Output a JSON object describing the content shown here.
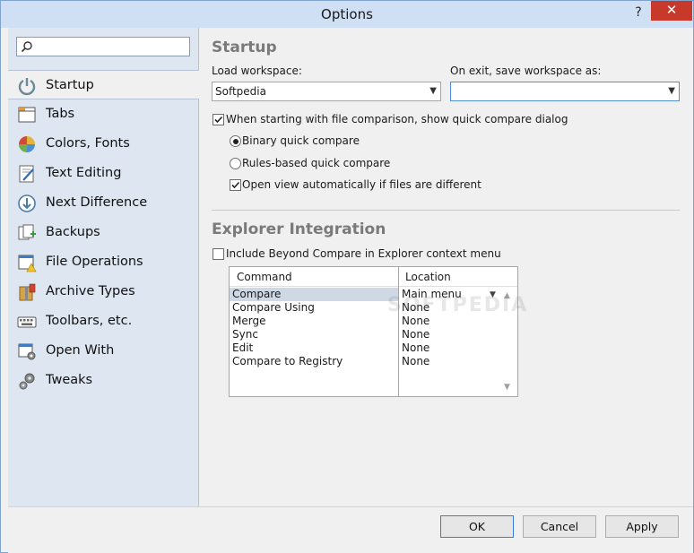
{
  "window": {
    "title": "Options",
    "help_glyph": "?",
    "close_glyph": "✕"
  },
  "search": {
    "value": "",
    "placeholder": ""
  },
  "sidebar": {
    "items": [
      {
        "label": "Startup",
        "icon": "power-icon"
      },
      {
        "label": "Tabs",
        "icon": "tabs-icon"
      },
      {
        "label": "Colors, Fonts",
        "icon": "color-pie-icon"
      },
      {
        "label": "Text Editing",
        "icon": "edit-pencil-icon"
      },
      {
        "label": "Next Difference",
        "icon": "down-arrow-circle-icon"
      },
      {
        "label": "Backups",
        "icon": "backups-icon"
      },
      {
        "label": "File Operations",
        "icon": "file-warning-icon"
      },
      {
        "label": "Archive Types",
        "icon": "archive-icon"
      },
      {
        "label": "Toolbars, etc.",
        "icon": "keyboard-icon"
      },
      {
        "label": "Open With",
        "icon": "open-with-icon"
      },
      {
        "label": "Tweaks",
        "icon": "gears-icon"
      }
    ]
  },
  "startup": {
    "title": "Startup",
    "load_workspace_label": "Load workspace:",
    "load_workspace_value": "Softpedia",
    "on_exit_label": "On exit, save workspace as:",
    "on_exit_value": "",
    "show_quick_compare": {
      "label": "When starting with file comparison, show quick compare dialog",
      "checked": true
    },
    "binary_quick_compare": {
      "label": "Binary quick compare",
      "selected": true
    },
    "rules_quick_compare": {
      "label": "Rules-based quick compare",
      "selected": false
    },
    "open_view_auto": {
      "label": "Open view automatically if files are different",
      "checked": true
    }
  },
  "explorer": {
    "title": "Explorer Integration",
    "include_context_menu": {
      "label": "Include Beyond Compare in Explorer context menu",
      "checked": false
    },
    "columns": [
      "Command",
      "Location"
    ],
    "rows": [
      {
        "command": "Compare",
        "location": "Main menu"
      },
      {
        "command": "Compare Using",
        "location": "None"
      },
      {
        "command": "Merge",
        "location": "None"
      },
      {
        "command": "Sync",
        "location": "None"
      },
      {
        "command": "Edit",
        "location": "None"
      },
      {
        "command": "Compare to Registry",
        "location": "None"
      }
    ],
    "selected_row": 0
  },
  "watermark": "SOFTPEDIA",
  "buttons": {
    "ok": "OK",
    "cancel": "Cancel",
    "apply": "Apply"
  },
  "colors": {
    "accent": "#3c7fd0",
    "sidebar_bg": "#dde6f1",
    "title_bg": "#cfe0f5",
    "close_red": "#c7392b"
  }
}
